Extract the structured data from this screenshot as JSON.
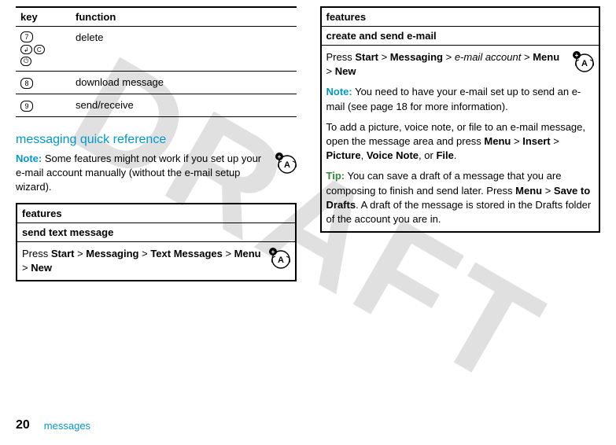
{
  "watermark": "DRAFT",
  "left": {
    "table": {
      "h1": "key",
      "h2": "function",
      "rows": [
        {
          "key_digits": [
            "7"
          ],
          "extra_keys": true,
          "func": "delete"
        },
        {
          "key_digits": [
            "8"
          ],
          "extra_keys": false,
          "func": "download message"
        },
        {
          "key_digits": [
            "9"
          ],
          "extra_keys": false,
          "func": "send/receive"
        }
      ]
    },
    "heading": "messaging quick reference",
    "note_label": "Note:",
    "note_text": " Some features might not work if you set up your e-mail account manually (without the e-mail setup wizard).",
    "feat": {
      "header": "features",
      "sub": "send text message",
      "press": "Press ",
      "p1": "Start",
      "gt": " > ",
      "p2": "Messaging",
      "p3": "Text Messages",
      "p4": "Menu",
      "p5": "New"
    }
  },
  "right": {
    "feat": {
      "header": "features",
      "sub": "create and send e-mail",
      "press": "Press ",
      "p1": "Start",
      "gt": " > ",
      "p2": "Messaging",
      "gt2": " > ",
      "p3_italic": "e-mail account",
      "gt3": " > ",
      "p4": "Menu",
      "gt4": " > ",
      "p5": "New",
      "note_label": "Note:",
      "note_text": " You need to have your e-mail set up to send an e-mail (see page 18 for more information).",
      "para2a": "To add a picture, voice note, or file to an e-mail message, open the message area and press ",
      "p6": "Menu",
      "gt5": " > ",
      "p7": "Insert",
      "gt6": " > ",
      "p8": "Picture",
      "comma": ", ",
      "p9": "Voice Note",
      "or": ", or ",
      "p10": "File",
      "period": ".",
      "tip_label": "Tip:",
      "tip_text_a": " You can save a draft of a message that you are composing to finish and send later. Press ",
      "p11": "Menu",
      "gt7": " > ",
      "p12": "Save to Drafts",
      "tip_text_b": ". A draft of the message is stored in the Drafts folder of the account you are in."
    }
  },
  "footer": {
    "page": "20",
    "section": "messages"
  }
}
